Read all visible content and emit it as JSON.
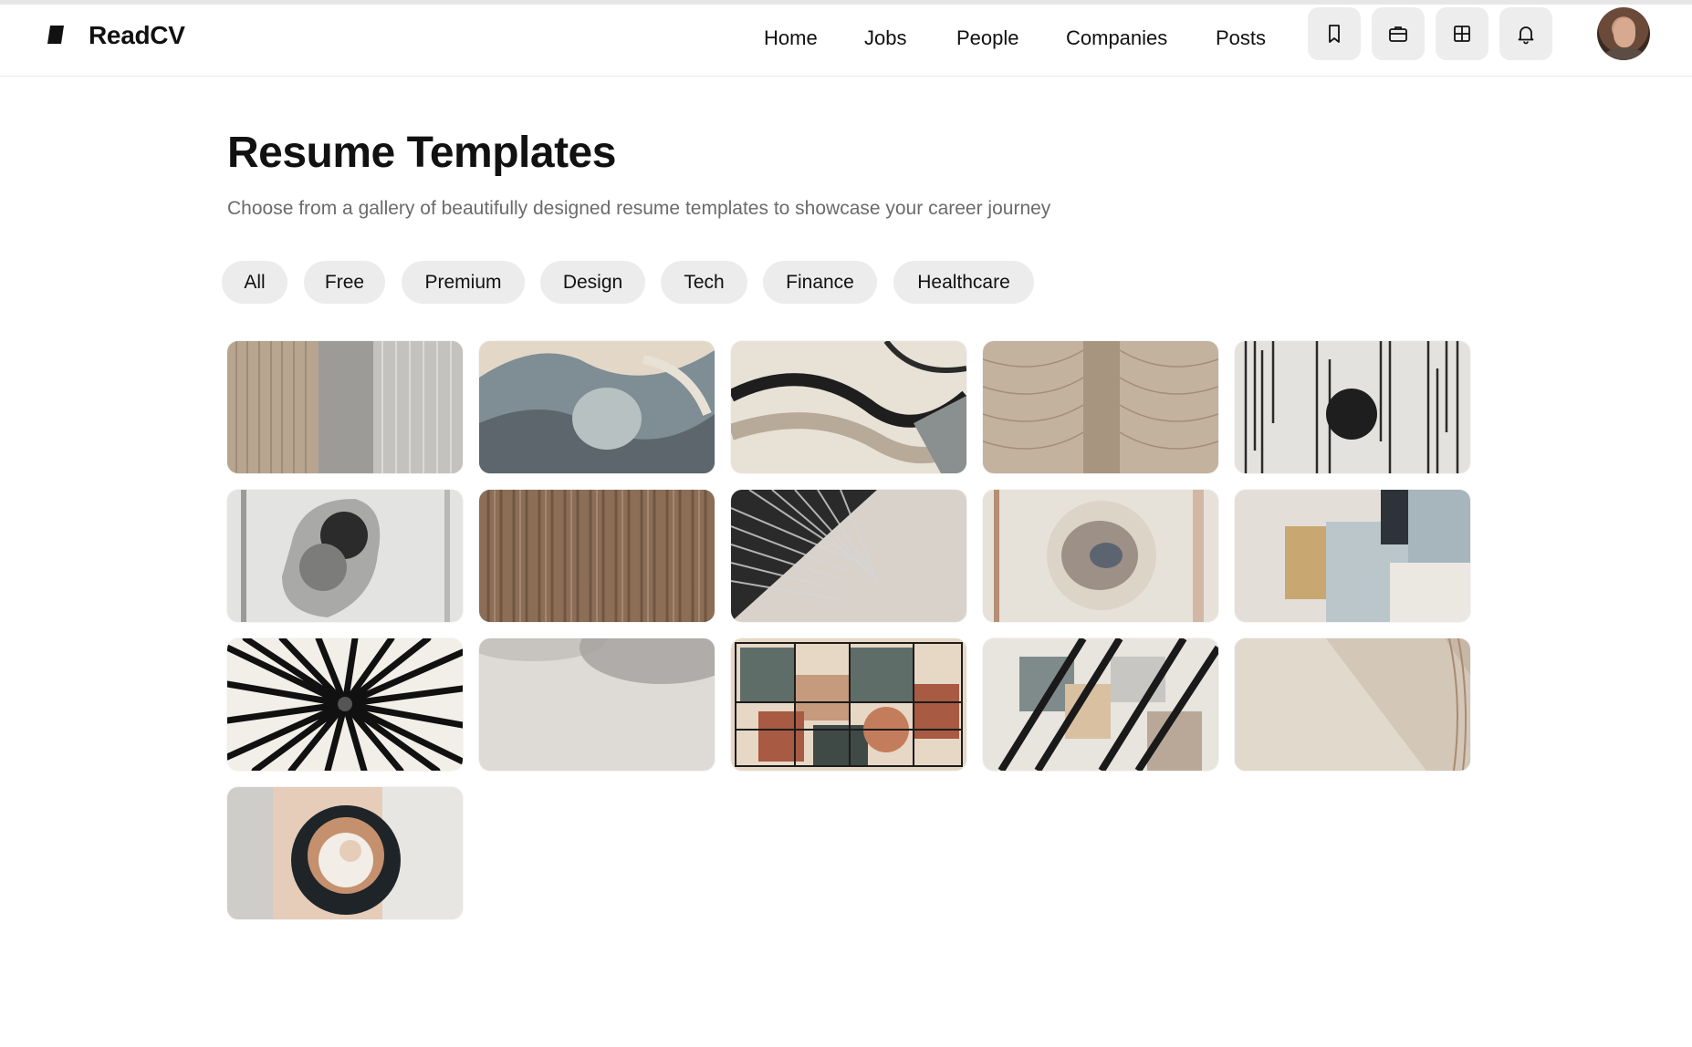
{
  "brand": {
    "name": "ReadCV"
  },
  "nav": {
    "links": [
      "Home",
      "Jobs",
      "People",
      "Companies",
      "Posts"
    ],
    "icons": [
      "bookmark-icon",
      "briefcase-icon",
      "grid-icon",
      "bell-icon"
    ]
  },
  "page": {
    "title": "Resume Templates",
    "subtitle": "Choose from a gallery of beautifully designed resume templates to showcase your career journey"
  },
  "filters": [
    "All",
    "Free",
    "Premium",
    "Design",
    "Tech",
    "Finance",
    "Healthcare"
  ],
  "templates": {
    "count": 16,
    "palette": [
      "#c2b09c",
      "#8e99a0",
      "#e8e1d6",
      "#2a2a2a",
      "#a88a72",
      "#5f6d68"
    ]
  }
}
